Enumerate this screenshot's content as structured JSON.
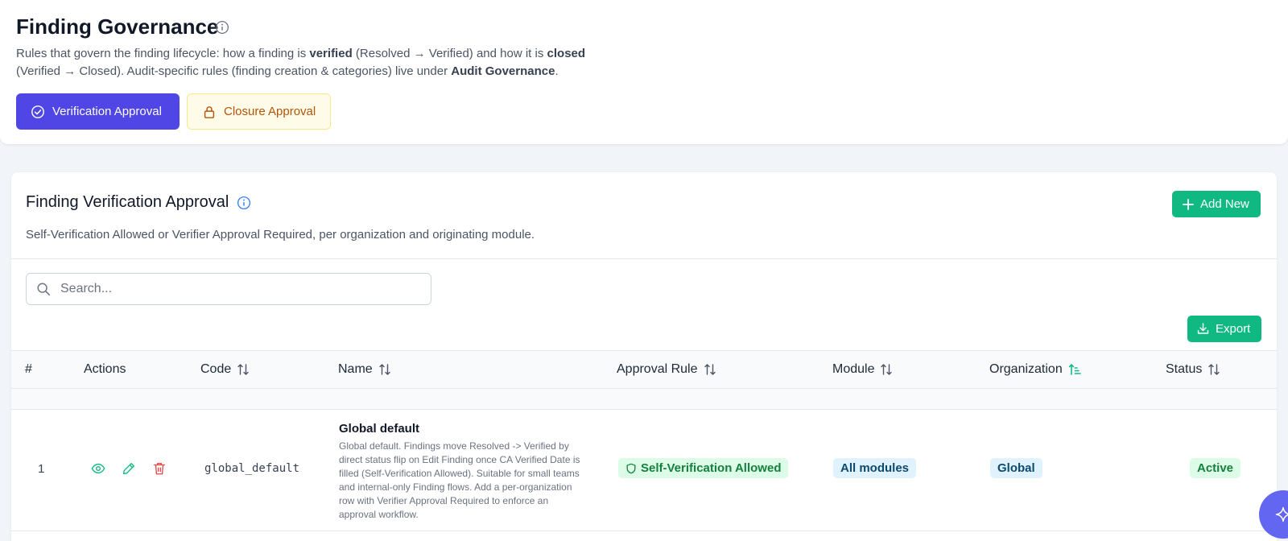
{
  "header": {
    "title": "Finding Governance",
    "desc_1": "Rules that govern the finding lifecycle: how a finding is ",
    "desc_verified": "verified",
    "desc_2": " (Resolved → Verified) and how it is ",
    "desc_closed": "closed",
    "desc_3": " (Verified → Closed). Audit-specific rules (finding creation & categories) live under ",
    "desc_audit": "Audit Governance",
    "desc_4": ".",
    "tabs": [
      {
        "label": "Verification Approval",
        "icon": "check-circle-icon",
        "active": true
      },
      {
        "label": "Closure Approval",
        "icon": "lock-icon",
        "active": false
      }
    ]
  },
  "section": {
    "title": "Finding Verification Approval",
    "description": "Self-Verification Allowed or Verifier Approval Required, per organization and originating module.",
    "add_label": "Add New",
    "export_label": "Export"
  },
  "search": {
    "placeholder": "Search..."
  },
  "table": {
    "columns": [
      "#",
      "Actions",
      "Code",
      "Name",
      "Approval Rule",
      "Module",
      "Organization",
      "Status"
    ],
    "rows": [
      {
        "num": "1",
        "code": "global_default",
        "name": "Global default",
        "description": "Global default. Findings move Resolved -> Verified by direct status flip on Edit Finding once CA Verified Date is filled (Self-Verification Allowed). Suitable for small teams and internal-only Finding flows. Add a per-organization row with Verifier Approval Required to enforce an approval workflow.",
        "approval_rule": "Self-Verification Allowed",
        "module": "All modules",
        "organization": "Global",
        "status": "Active"
      }
    ]
  },
  "colors": {
    "primary": "#4f46e5",
    "success": "#10b981",
    "closure_bg": "#fefce8",
    "closure_text": "#b45309"
  }
}
